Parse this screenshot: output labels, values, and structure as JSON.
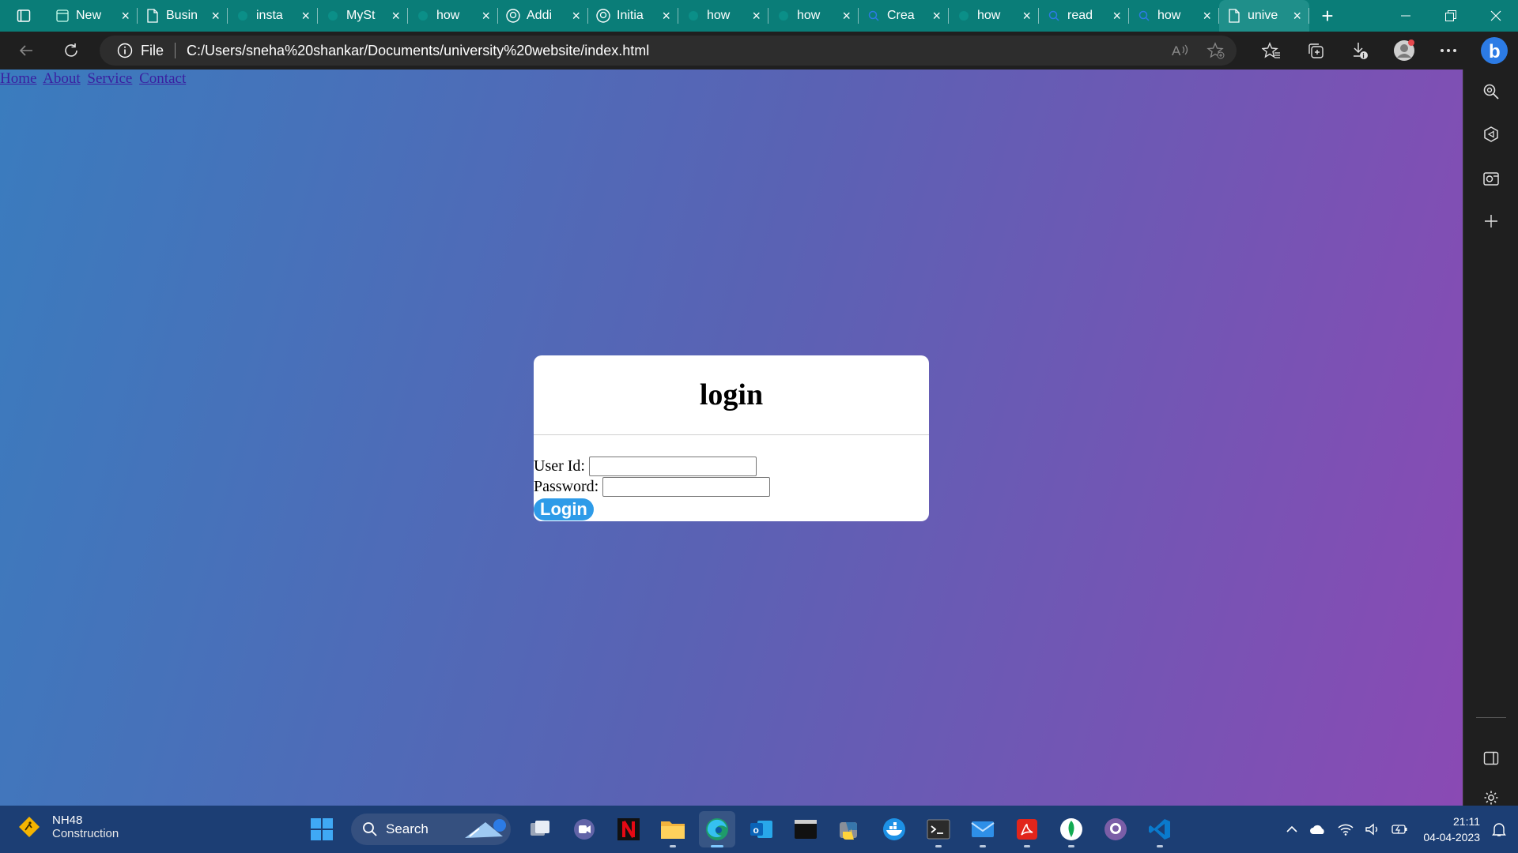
{
  "browser": {
    "tabs": [
      {
        "label": "New",
        "icon": "page-icon"
      },
      {
        "label": "Busin",
        "icon": "file-icon"
      },
      {
        "label": "insta",
        "icon": "site-icon"
      },
      {
        "label": "MySt",
        "icon": "site-icon"
      },
      {
        "label": "how",
        "icon": "site-icon"
      },
      {
        "label": "Addi",
        "icon": "github-icon"
      },
      {
        "label": "Initia",
        "icon": "github-icon"
      },
      {
        "label": "how",
        "icon": "site-icon"
      },
      {
        "label": "how",
        "icon": "site-icon"
      },
      {
        "label": "Crea",
        "icon": "search-icon"
      },
      {
        "label": "how",
        "icon": "site-icon"
      },
      {
        "label": "read",
        "icon": "search-icon"
      },
      {
        "label": "how",
        "icon": "search-icon"
      },
      {
        "label": "unive",
        "icon": "file-icon",
        "active": true
      }
    ],
    "address": {
      "scheme_label": "File",
      "url": "C:/Users/sneha%20shankar/Documents/university%20website/index.html"
    },
    "accent": "#0a7d78"
  },
  "page": {
    "nav": {
      "home": "Home",
      "about": "About",
      "service": "Service",
      "contact": "Contact"
    },
    "login": {
      "title": "login",
      "user_label": "User Id:",
      "password_label": "Password:",
      "user_value": "",
      "password_value": "",
      "button_label": "Login"
    },
    "gradient": [
      "#3a7cbe",
      "#8a4ab4"
    ]
  },
  "taskbar": {
    "weather": {
      "title": "NH48",
      "subtitle": "Construction"
    },
    "search_label": "Search",
    "clock": {
      "time": "21:11",
      "date": "04-04-2023"
    }
  }
}
